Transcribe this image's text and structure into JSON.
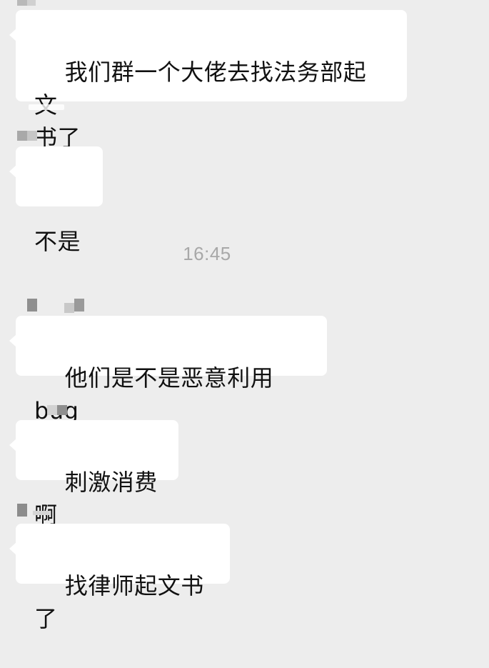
{
  "chat": {
    "messages": [
      {
        "text": "我们群一个大佬去找法务部起文\n书了"
      },
      {
        "text": "不是"
      },
      {
        "text": "他们是不是恶意利用 bug"
      },
      {
        "text": "刺激消费啊"
      },
      {
        "text": "找律师起文书了"
      }
    ],
    "timestamp": "16:45"
  },
  "colors": {
    "background": "#ededed",
    "bubble": "#ffffff",
    "text": "#111111",
    "timestamp": "#a8a8a8",
    "pixelated_name": "#9a9a9a"
  }
}
